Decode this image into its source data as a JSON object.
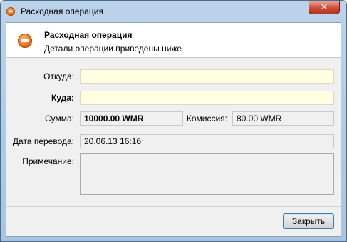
{
  "window": {
    "title": "Расходная операция",
    "close_glyph": "✕"
  },
  "header": {
    "title": "Расходная операция",
    "subtitle": "Детали операции приведены ниже"
  },
  "form": {
    "from_label": "Откуда:",
    "from_value": "",
    "to_label": "Куда:",
    "to_value": "",
    "amount_label": "Сумма:",
    "amount_value": "10000.00 WMR",
    "fee_label": "Комиссия:",
    "fee_value": "80.00 WMR",
    "date_label": "Дата перевода:",
    "date_value": "20.06.13 16:16",
    "note_label": "Примечание:",
    "note_value": ""
  },
  "buttons": {
    "close_label": "Закрыть"
  },
  "colors": {
    "highlight_field": "#ffffe1",
    "close_red": "#cf4a34",
    "icon_orange": "#e0620d"
  }
}
